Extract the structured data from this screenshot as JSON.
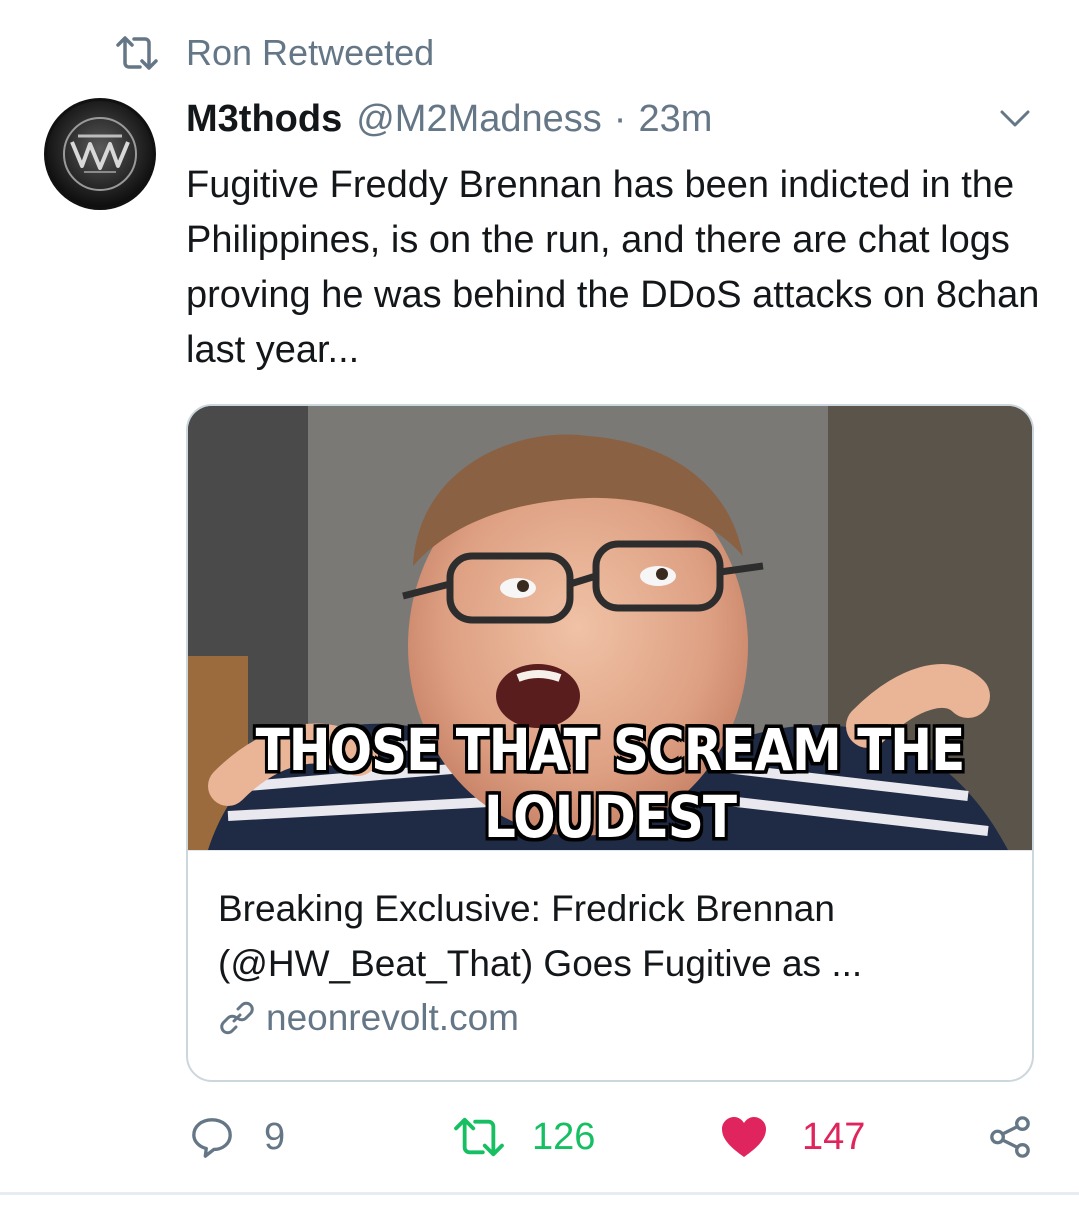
{
  "retweet_context": {
    "label": "Ron Retweeted",
    "icon": "retweet-icon"
  },
  "author": {
    "display_name": "M3thods",
    "handle": "@M2Madness",
    "separator": "·",
    "time": "23m",
    "avatar_icon": "m3thods-logo-avatar"
  },
  "tweet": {
    "text": "Fugitive Freddy Brennan has been indicted in the Philippines, is on the run, and there are chat logs proving he was behind the DDoS attacks on 8chan last year..."
  },
  "card": {
    "image_caption": "THOSE THAT SCREAM THE LOUDEST",
    "title": "Breaking Exclusive: Fredrick Brennan (@HW_Beat_That) Goes Fugitive as ...",
    "domain": "neonrevolt.com",
    "domain_icon": "link-icon"
  },
  "actions": {
    "reply_count": "9",
    "retweet_count": "126",
    "like_count": "147",
    "reply_icon": "reply-icon",
    "retweet_icon": "retweet-icon",
    "like_icon": "heart-icon",
    "share_icon": "share-icon"
  },
  "colors": {
    "secondary_text": "#657786",
    "retweet_green": "#17bf63",
    "like_red": "#e0245e",
    "border": "#ccd6dd"
  }
}
